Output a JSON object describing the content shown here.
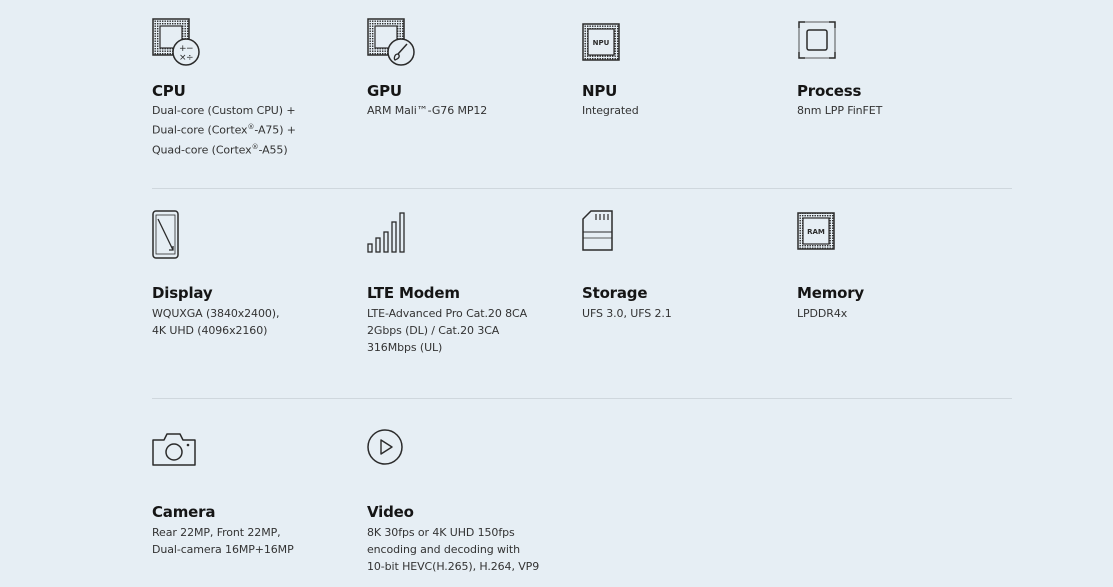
{
  "specs": {
    "row1": [
      {
        "icon": "cpu-calculator-icon",
        "title": "CPU",
        "desc": "Dual-core (Custom CPU) +\nDual-core (Cortex®-A75) +\nQuad-core (Cortex®-A55)"
      },
      {
        "icon": "gpu-brush-icon",
        "title": "GPU",
        "desc": "ARM Mali™-G76 MP12"
      },
      {
        "icon": "npu-chip-icon",
        "icon_label": "NPU",
        "title": "NPU",
        "desc": "Integrated"
      },
      {
        "icon": "process-frame-icon",
        "title": "Process",
        "desc": "8nm LPP FinFET"
      }
    ],
    "row2": [
      {
        "icon": "display-phone-icon",
        "title": "Display",
        "desc": "WQUXGA (3840x2400),\n4K UHD (4096x2160)"
      },
      {
        "icon": "signal-bars-icon",
        "title": "LTE Modem",
        "desc": "LTE-Advanced Pro Cat.20 8CA\n2Gbps (DL) / Cat.20 3CA\n316Mbps (UL)"
      },
      {
        "icon": "sd-card-icon",
        "title": "Storage",
        "desc": "UFS 3.0, UFS 2.1"
      },
      {
        "icon": "ram-chip-icon",
        "icon_label": "RAM",
        "title": "Memory",
        "desc": "LPDDR4x"
      }
    ],
    "row3": [
      {
        "icon": "camera-icon",
        "title": "Camera",
        "desc": "Rear 22MP, Front 22MP,\nDual-camera 16MP+16MP"
      },
      {
        "icon": "play-icon",
        "title": "Video",
        "desc": "8K 30fps or 4K UHD 150fps\nencoding and decoding with\n10-bit HEVC(H.265), H.264, VP9"
      }
    ]
  },
  "colors": {
    "background": "#e6eef4",
    "icon_stroke": "#2b2b2b",
    "divider": "#cfd7dd"
  }
}
